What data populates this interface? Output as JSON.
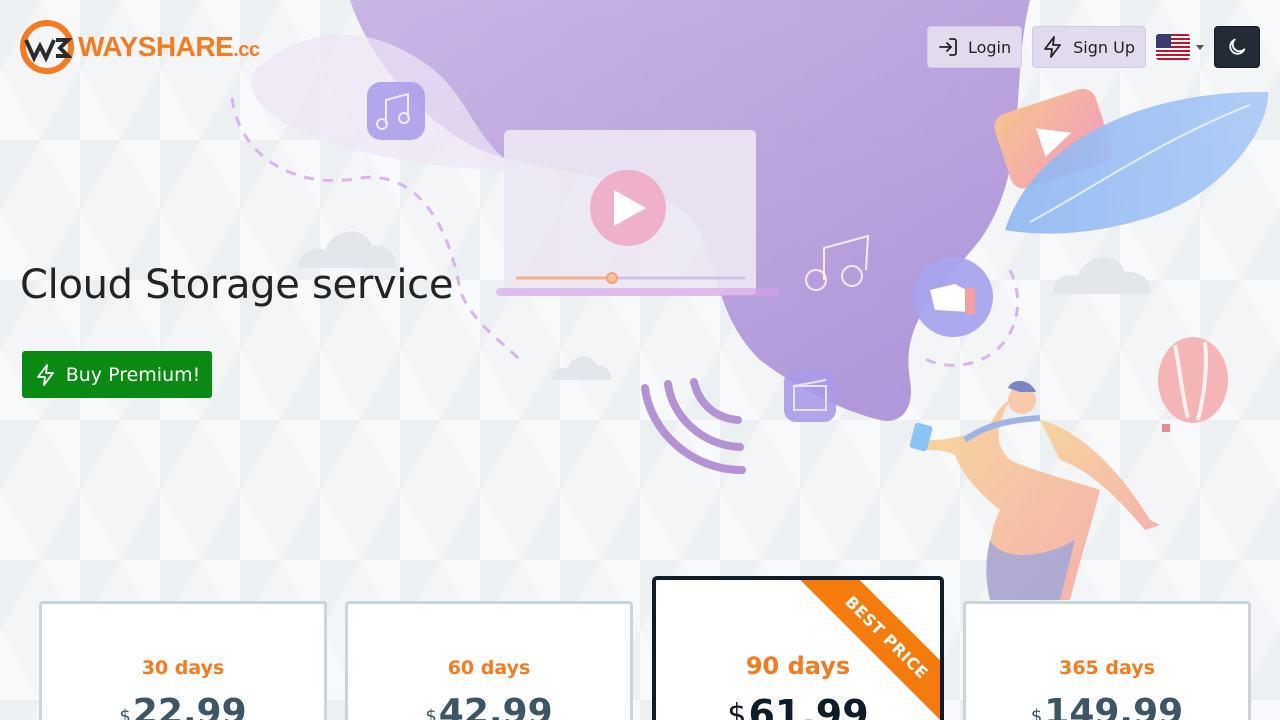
{
  "brand": {
    "name": "WAYSHARE",
    "tld": ".cc",
    "color": "#f47b20"
  },
  "nav": {
    "login_label": "Login",
    "signup_label": "Sign Up",
    "language_icon": "us-flag-icon",
    "theme_icon": "moon-icon"
  },
  "hero": {
    "title": "Cloud Storage service",
    "cta_label": "Buy Premium!",
    "cta_color": "#0a8a12"
  },
  "plans": [
    {
      "days": "30 days",
      "currency": "$",
      "price": "22.99"
    },
    {
      "days": "60 days",
      "currency": "$",
      "price": "42.99"
    },
    {
      "days": "90 days",
      "currency": "$",
      "price": "61.99",
      "badge": "BEST PRICE"
    },
    {
      "days": "365 days",
      "currency": "$",
      "price": "149.99"
    }
  ],
  "colors": {
    "accent": "#f47b20",
    "purple": "#b49cd9",
    "dark": "#0f1c2a"
  }
}
